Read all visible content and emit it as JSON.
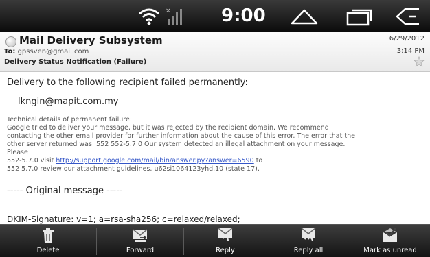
{
  "status_bar": {
    "time": "9:00",
    "icons": [
      "wifi-icon",
      "signal-icon",
      "home-icon",
      "recent-apps-icon",
      "back-icon"
    ]
  },
  "email": {
    "sender": "Mail Delivery Subsystem",
    "to_label": "To:",
    "to_value": "gpssven@gmail.com",
    "subject": "Delivery Status Notification (Failure)",
    "date": "6/29/2012",
    "time": "3:14 PM"
  },
  "body": {
    "intro": "Delivery to the following recipient failed permanently:",
    "recipient": "lkngin@mapit.com.my",
    "tech_lines": [
      "Technical details of permanent failure:",
      "Google tried to deliver your message, but it was rejected by the recipient domain. We recommend",
      "contacting the other email provider for further information about the cause of this error. The error that the",
      "other server returned was: 552 552-5.7.0 Our system detected an illegal attachment on your message.",
      "Please"
    ],
    "link_line_prefix": "552-5.7.0 visit ",
    "link_text": "http://support.google.com/mail/bin/answer.py?answer=6590",
    "link_line_suffix": " to",
    "review_line": "552 5.7.0 review our attachment guidelines. u62si1064123yhd.10 (state 17).",
    "original_message": "----- Original message -----",
    "dkim": "DKIM-Signature: v=1; a=rsa-sha256; c=relaxed/relaxed;"
  },
  "actions": [
    {
      "label": "Delete",
      "icon": "trash-icon"
    },
    {
      "label": "Forward",
      "icon": "forward-icon"
    },
    {
      "label": "Reply",
      "icon": "reply-icon"
    },
    {
      "label": "Reply all",
      "icon": "reply-all-icon"
    },
    {
      "label": "Mark as unread",
      "icon": "mark-unread-icon"
    }
  ],
  "colors": {
    "status_bar": "#0c0c0c",
    "action_bar": "#141414",
    "link": "#3456c8"
  }
}
